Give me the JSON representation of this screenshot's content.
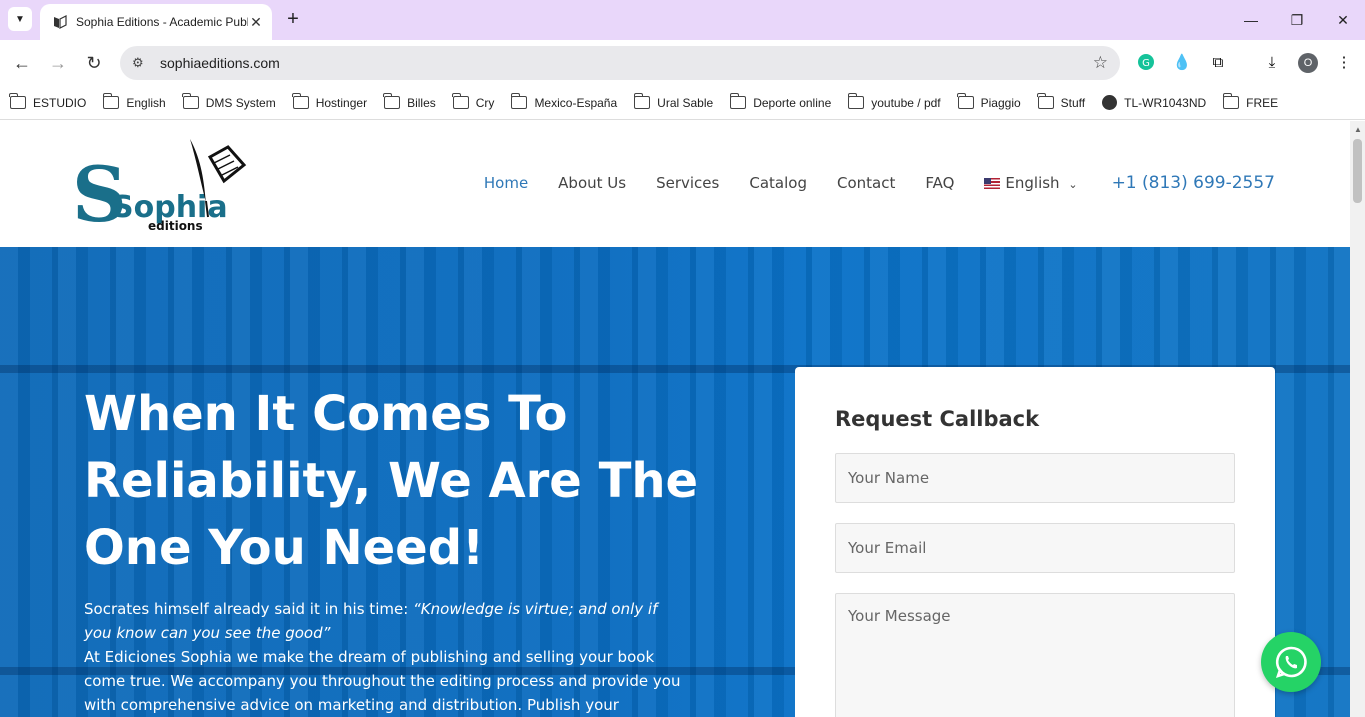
{
  "browser": {
    "tab_title": "Sophia Editions - Academic Publ",
    "url": "sophiaeditions.com",
    "profile_initial": "O",
    "bookmarks": [
      "ESTUDIO",
      "English",
      "DMS System",
      "Hostinger",
      "Billes",
      "Cry",
      "Mexico-España",
      "Ural Sable",
      "Deporte online",
      "youtube / pdf",
      "Piaggio",
      "Stuff",
      "TL-WR1043ND",
      "FREE"
    ]
  },
  "site": {
    "logo": {
      "word": "Sophia",
      "sub": "editions"
    },
    "nav": [
      "Home",
      "About Us",
      "Services",
      "Catalog",
      "Contact",
      "FAQ"
    ],
    "language": "English",
    "phone": "+1 (813) 699-2557"
  },
  "hero": {
    "title_line1": "When It Comes To",
    "title_line2": "Reliability, We Are The",
    "title_line3": "One You Need!",
    "intro": "Socrates himself already said it in his time: ",
    "quote": "“Knowledge is virtue; and only if you know can you see the good”",
    "body": "At Ediciones Sophia we make the dream of publishing and selling your book come true. We accompany you throughout the editing process and provide you with comprehensive advice on marketing and distribution. Publish your"
  },
  "callback": {
    "title": "Request Callback",
    "name_placeholder": "Your Name",
    "email_placeholder": "Your Email",
    "message_placeholder": "Your Message"
  },
  "colors": {
    "accent": "#2f78b7",
    "hero_blue": "#0a6cc0",
    "logo_teal": "#1a6f8a",
    "whatsapp": "#25d366"
  }
}
